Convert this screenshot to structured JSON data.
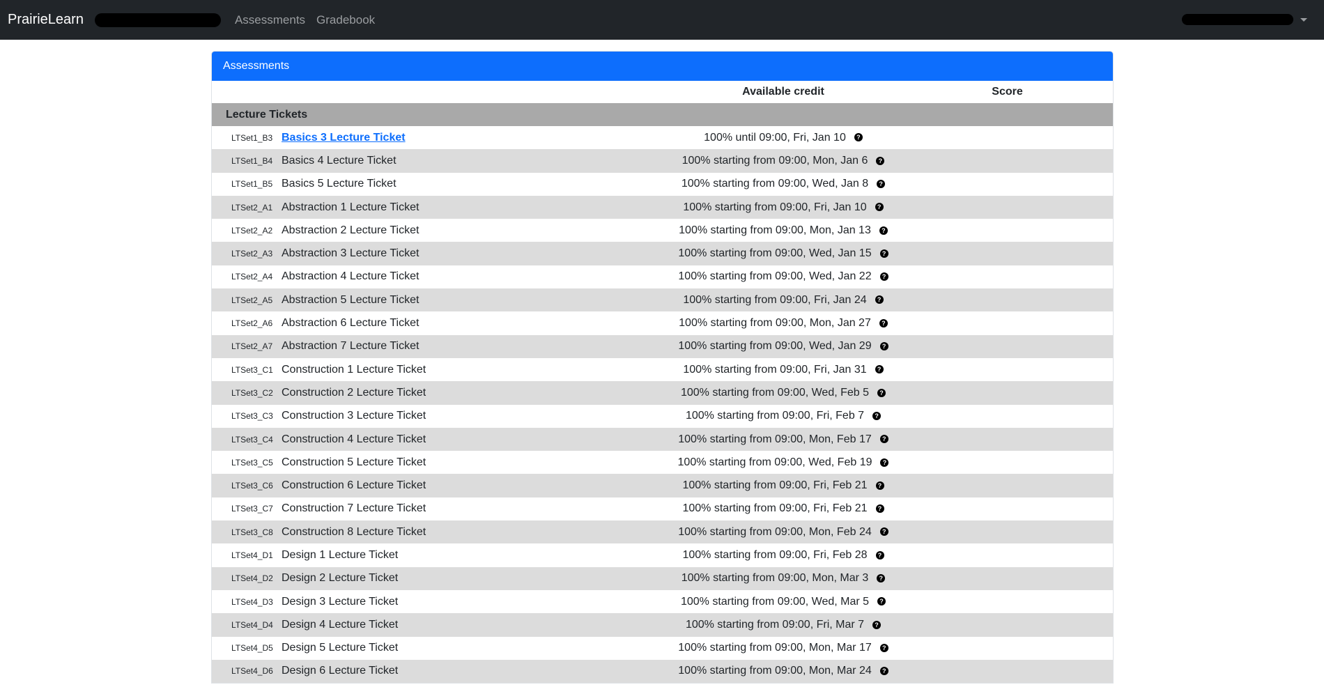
{
  "navbar": {
    "brand": "PrairieLearn",
    "links": [
      "Assessments",
      "Gradebook"
    ]
  },
  "card": {
    "title": "Assessments",
    "columns": {
      "available_credit": "Available credit",
      "score": "Score"
    },
    "group": "Lecture Tickets",
    "help_icon": "question-circle-icon",
    "rows": [
      {
        "label": "LTSet1_B3",
        "title": "Basics 3 Lecture Ticket",
        "credit": "100% until 09:00, Fri, Jan 10",
        "link": true
      },
      {
        "label": "LTSet1_B4",
        "title": "Basics 4 Lecture Ticket",
        "credit": "100% starting from 09:00, Mon, Jan 6",
        "link": false
      },
      {
        "label": "LTSet1_B5",
        "title": "Basics 5 Lecture Ticket",
        "credit": "100% starting from 09:00, Wed, Jan 8",
        "link": false
      },
      {
        "label": "LTSet2_A1",
        "title": "Abstraction 1 Lecture Ticket",
        "credit": "100% starting from 09:00, Fri, Jan 10",
        "link": false
      },
      {
        "label": "LTSet2_A2",
        "title": "Abstraction 2 Lecture Ticket",
        "credit": "100% starting from 09:00, Mon, Jan 13",
        "link": false
      },
      {
        "label": "LTSet2_A3",
        "title": "Abstraction 3 Lecture Ticket",
        "credit": "100% starting from 09:00, Wed, Jan 15",
        "link": false
      },
      {
        "label": "LTSet2_A4",
        "title": "Abstraction 4 Lecture Ticket",
        "credit": "100% starting from 09:00, Wed, Jan 22",
        "link": false
      },
      {
        "label": "LTSet2_A5",
        "title": "Abstraction 5 Lecture Ticket",
        "credit": "100% starting from 09:00, Fri, Jan 24",
        "link": false
      },
      {
        "label": "LTSet2_A6",
        "title": "Abstraction 6 Lecture Ticket",
        "credit": "100% starting from 09:00, Mon, Jan 27",
        "link": false
      },
      {
        "label": "LTSet2_A7",
        "title": "Abstraction 7 Lecture Ticket",
        "credit": "100% starting from 09:00, Wed, Jan 29",
        "link": false
      },
      {
        "label": "LTSet3_C1",
        "title": "Construction 1 Lecture Ticket",
        "credit": "100% starting from 09:00, Fri, Jan 31",
        "link": false
      },
      {
        "label": "LTSet3_C2",
        "title": "Construction 2 Lecture Ticket",
        "credit": "100% starting from 09:00, Wed, Feb 5",
        "link": false
      },
      {
        "label": "LTSet3_C3",
        "title": "Construction 3 Lecture Ticket",
        "credit": "100% starting from 09:00, Fri, Feb 7",
        "link": false
      },
      {
        "label": "LTSet3_C4",
        "title": "Construction 4 Lecture Ticket",
        "credit": "100% starting from 09:00, Mon, Feb 17",
        "link": false
      },
      {
        "label": "LTSet3_C5",
        "title": "Construction 5 Lecture Ticket",
        "credit": "100% starting from 09:00, Wed, Feb 19",
        "link": false
      },
      {
        "label": "LTSet3_C6",
        "title": "Construction 6 Lecture Ticket",
        "credit": "100% starting from 09:00, Fri, Feb 21",
        "link": false
      },
      {
        "label": "LTSet3_C7",
        "title": "Construction 7 Lecture Ticket",
        "credit": "100% starting from 09:00, Fri, Feb 21",
        "link": false
      },
      {
        "label": "LTSet3_C8",
        "title": "Construction 8 Lecture Ticket",
        "credit": "100% starting from 09:00, Mon, Feb 24",
        "link": false
      },
      {
        "label": "LTSet4_D1",
        "title": "Design 1 Lecture Ticket",
        "credit": "100% starting from 09:00, Fri, Feb 28",
        "link": false
      },
      {
        "label": "LTSet4_D2",
        "title": "Design 2 Lecture Ticket",
        "credit": "100% starting from 09:00, Mon, Mar 3",
        "link": false
      },
      {
        "label": "LTSet4_D3",
        "title": "Design 3 Lecture Ticket",
        "credit": "100% starting from 09:00, Wed, Mar 5",
        "link": false
      },
      {
        "label": "LTSet4_D4",
        "title": "Design 4 Lecture Ticket",
        "credit": "100% starting from 09:00, Fri, Mar 7",
        "link": false
      },
      {
        "label": "LTSet4_D5",
        "title": "Design 5 Lecture Ticket",
        "credit": "100% starting from 09:00, Mon, Mar 17",
        "link": false
      },
      {
        "label": "LTSet4_D6",
        "title": "Design 6 Lecture Ticket",
        "credit": "100% starting from 09:00, Mon, Mar 24",
        "link": false
      }
    ]
  },
  "colors": {
    "navbar_bg": "#212529",
    "header_blue": "#0d6efd",
    "group_gray": "#a9a9a9",
    "stripe_gray": "#dcdcdc"
  }
}
